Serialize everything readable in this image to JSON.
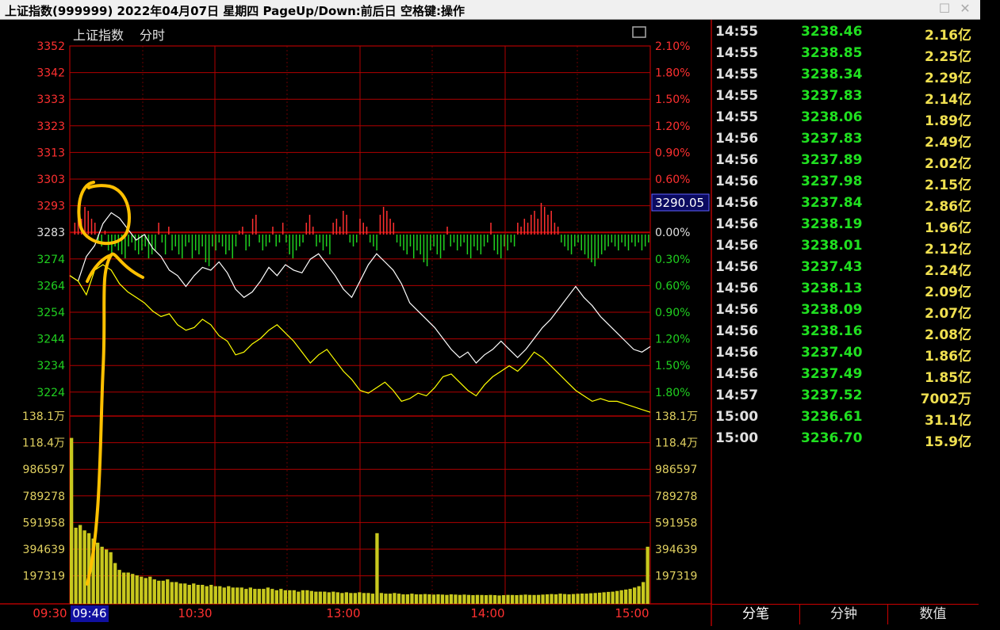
{
  "window": {
    "title": "上证指数(999999)  2022年04月07日  星期四  PageUp/Down:前后日  空格键:操作"
  },
  "chart_header": {
    "index_name": "上证指数",
    "mode": "分时",
    "current_price_badge": "3290.05"
  },
  "colors": {
    "grid": "#b00000",
    "up": "#ff3030",
    "down": "#20d020",
    "price_line": "#ffffff",
    "avg_line": "#ffff00",
    "volume": "#c8c81e",
    "annotation": "#ffc000"
  },
  "chart_data": [
    {
      "type": "line",
      "name": "price",
      "ylabels_left": [
        "3352",
        "3342",
        "3333",
        "3323",
        "3313",
        "3303",
        "3293",
        "3283",
        "3274",
        "3264",
        "3254",
        "3244",
        "3234",
        "3224"
      ],
      "ylabels_right": [
        "2.10%",
        "1.80%",
        "1.50%",
        "1.20%",
        "0.90%",
        "0.60%",
        "0.30%",
        "0.00%",
        "0.30%",
        "0.60%",
        "0.90%",
        "1.20%",
        "1.50%",
        "1.80%"
      ],
      "ylim": [
        3220.5,
        3352
      ],
      "prev_close": 3283,
      "xlabels": [
        "09:30",
        "10:30",
        "13:00",
        "14:00",
        "15:00"
      ],
      "xlabel_cursor": "09:46",
      "series": [
        {
          "values": [
            3268,
            3266,
            3275,
            3279,
            3287,
            3291,
            3289,
            3285,
            3281,
            3283,
            3278,
            3275,
            3270,
            3268,
            3264,
            3268,
            3271,
            3270,
            3273,
            3269,
            3263,
            3260,
            3262,
            3266,
            3271,
            3268,
            3272,
            3270,
            3269,
            3274,
            3276,
            3272,
            3268,
            3263,
            3260,
            3266,
            3272,
            3276,
            3273,
            3270,
            3265,
            3258,
            3255,
            3252,
            3249,
            3245,
            3241,
            3238,
            3240,
            3236,
            3239,
            3241,
            3244,
            3241,
            3238,
            3241,
            3245,
            3249,
            3252,
            3256,
            3260,
            3264,
            3260,
            3257,
            3253,
            3250,
            3247,
            3244,
            3241,
            3240,
            3242
          ]
        },
        {
          "values": [
            3268,
            3266,
            3261,
            3270,
            3272,
            3270,
            3265,
            3262,
            3260,
            3258,
            3255,
            3253,
            3254,
            3250,
            3248,
            3249,
            3252,
            3250,
            3246,
            3244,
            3239,
            3240,
            3243,
            3245,
            3248,
            3250,
            3247,
            3244,
            3240,
            3236,
            3239,
            3241,
            3237,
            3233,
            3230,
            3226,
            3225,
            3227,
            3229,
            3226,
            3222,
            3223,
            3225,
            3224,
            3227,
            3231,
            3232,
            3229,
            3226,
            3224,
            3228,
            3231,
            3233,
            3235,
            3233,
            3236,
            3240,
            3238,
            3235,
            3232,
            3229,
            3226,
            3224,
            3222,
            3223,
            3222,
            3222,
            3221,
            3220,
            3219,
            3218
          ]
        }
      ]
    },
    {
      "type": "bar",
      "name": "breadth",
      "baseline": 3283,
      "values": [
        0,
        3,
        5,
        4,
        7,
        6,
        4,
        3,
        -2,
        -3,
        1,
        -4,
        -5,
        -3,
        -4,
        -5,
        -6,
        -3,
        -2,
        -4,
        -5,
        -4,
        -3,
        -6,
        -5,
        -4,
        3,
        -2,
        -5,
        2,
        -4,
        -3,
        -5,
        -6,
        -3,
        -2,
        -6,
        -4,
        -5,
        -3,
        -7,
        -8,
        -3,
        -4,
        -2,
        -3,
        -5,
        -4,
        -6,
        -3,
        1,
        2,
        -4,
        -3,
        4,
        5,
        -2,
        -4,
        -3,
        -2,
        2,
        -3,
        -2,
        3,
        -2,
        -5,
        -6,
        -4,
        -3,
        -2,
        3,
        5,
        2,
        -3,
        -2,
        -4,
        -3,
        -5,
        3,
        4,
        2,
        6,
        5,
        -2,
        -3,
        -2,
        4,
        3,
        2,
        -2,
        -3,
        -4,
        5,
        7,
        6,
        4,
        3,
        -2,
        -3,
        -4,
        -5,
        -3,
        -6,
        -4,
        -5,
        -7,
        -8,
        -4,
        -3,
        -5,
        -6,
        -4,
        2,
        -3,
        -2,
        -4,
        -3,
        -2,
        -5,
        -6,
        -3,
        -4,
        -5,
        -3,
        -2,
        3,
        -4,
        -5,
        -6,
        -3,
        -4,
        -2,
        -3,
        3,
        2,
        4,
        3,
        5,
        6,
        4,
        8,
        7,
        5,
        6,
        3,
        2,
        -2,
        -3,
        -4,
        -5,
        -3,
        -2,
        -4,
        -5,
        -6,
        -7,
        -8,
        -6,
        -5,
        -4,
        -3,
        -2,
        -3,
        -4,
        -2,
        -3,
        -4,
        -2,
        -3,
        -2,
        -4,
        -3,
        -2
      ]
    },
    {
      "type": "bar",
      "name": "volume",
      "ylabels_left": [
        "138.1万",
        "118.4万",
        "986597",
        "789278",
        "591958",
        "394639",
        "197319"
      ],
      "ylabels_right": [
        "138.1万",
        "118.4万",
        "986597",
        "789278",
        "591958",
        "394639",
        "197319"
      ],
      "ylim": [
        0,
        1381000
      ],
      "values": [
        1220000,
        560000,
        580000,
        540000,
        520000,
        480000,
        450000,
        420000,
        400000,
        380000,
        300000,
        250000,
        230000,
        230000,
        220000,
        210000,
        200000,
        190000,
        200000,
        180000,
        170000,
        170000,
        180000,
        160000,
        160000,
        150000,
        150000,
        140000,
        150000,
        140000,
        140000,
        130000,
        140000,
        130000,
        130000,
        120000,
        130000,
        120000,
        120000,
        120000,
        110000,
        120000,
        110000,
        110000,
        110000,
        120000,
        110000,
        100000,
        110000,
        100000,
        100000,
        100000,
        90000,
        100000,
        100000,
        95000,
        90000,
        90000,
        90000,
        85000,
        90000,
        85000,
        80000,
        85000,
        80000,
        80000,
        85000,
        80000,
        80000,
        75000,
        520000,
        80000,
        75000,
        75000,
        80000,
        75000,
        70000,
        70000,
        75000,
        70000,
        70000,
        72000,
        70000,
        68000,
        70000,
        68000,
        66000,
        70000,
        68000,
        66000,
        68000,
        66000,
        64000,
        66000,
        65000,
        64000,
        66000,
        64000,
        62000,
        64000,
        66000,
        65000,
        64000,
        66000,
        68000,
        66000,
        65000,
        66000,
        68000,
        70000,
        72000,
        70000,
        75000,
        72000,
        70000,
        72000,
        74000,
        76000,
        75000,
        78000,
        80000,
        82000,
        85000,
        88000,
        90000,
        95000,
        100000,
        105000,
        110000,
        120000,
        130000,
        160000,
        420000
      ]
    }
  ],
  "ticks": [
    {
      "time": "14:55",
      "price": "3238.46",
      "vol": "2.16亿"
    },
    {
      "time": "14:55",
      "price": "3238.85",
      "vol": "2.25亿"
    },
    {
      "time": "14:55",
      "price": "3238.34",
      "vol": "2.29亿"
    },
    {
      "time": "14:55",
      "price": "3237.83",
      "vol": "2.14亿"
    },
    {
      "time": "14:55",
      "price": "3238.06",
      "vol": "1.89亿"
    },
    {
      "time": "14:56",
      "price": "3237.83",
      "vol": "2.49亿"
    },
    {
      "time": "14:56",
      "price": "3237.89",
      "vol": "2.02亿"
    },
    {
      "time": "14:56",
      "price": "3237.98",
      "vol": "2.15亿"
    },
    {
      "time": "14:56",
      "price": "3237.84",
      "vol": "2.86亿"
    },
    {
      "time": "14:56",
      "price": "3238.19",
      "vol": "1.96亿"
    },
    {
      "time": "14:56",
      "price": "3238.01",
      "vol": "2.12亿"
    },
    {
      "time": "14:56",
      "price": "3237.43",
      "vol": "2.24亿"
    },
    {
      "time": "14:56",
      "price": "3238.13",
      "vol": "2.09亿"
    },
    {
      "time": "14:56",
      "price": "3238.09",
      "vol": "2.07亿"
    },
    {
      "time": "14:56",
      "price": "3238.16",
      "vol": "2.08亿"
    },
    {
      "time": "14:56",
      "price": "3237.40",
      "vol": "1.86亿"
    },
    {
      "time": "14:56",
      "price": "3237.49",
      "vol": "1.85亿"
    },
    {
      "time": "14:57",
      "price": "3237.52",
      "vol": "7002万"
    },
    {
      "time": "15:00",
      "price": "3236.61",
      "vol": "31.1亿"
    },
    {
      "time": "15:00",
      "price": "3236.70",
      "vol": "15.9亿"
    }
  ],
  "tabs": [
    "分笔",
    "分钟",
    "数值"
  ]
}
